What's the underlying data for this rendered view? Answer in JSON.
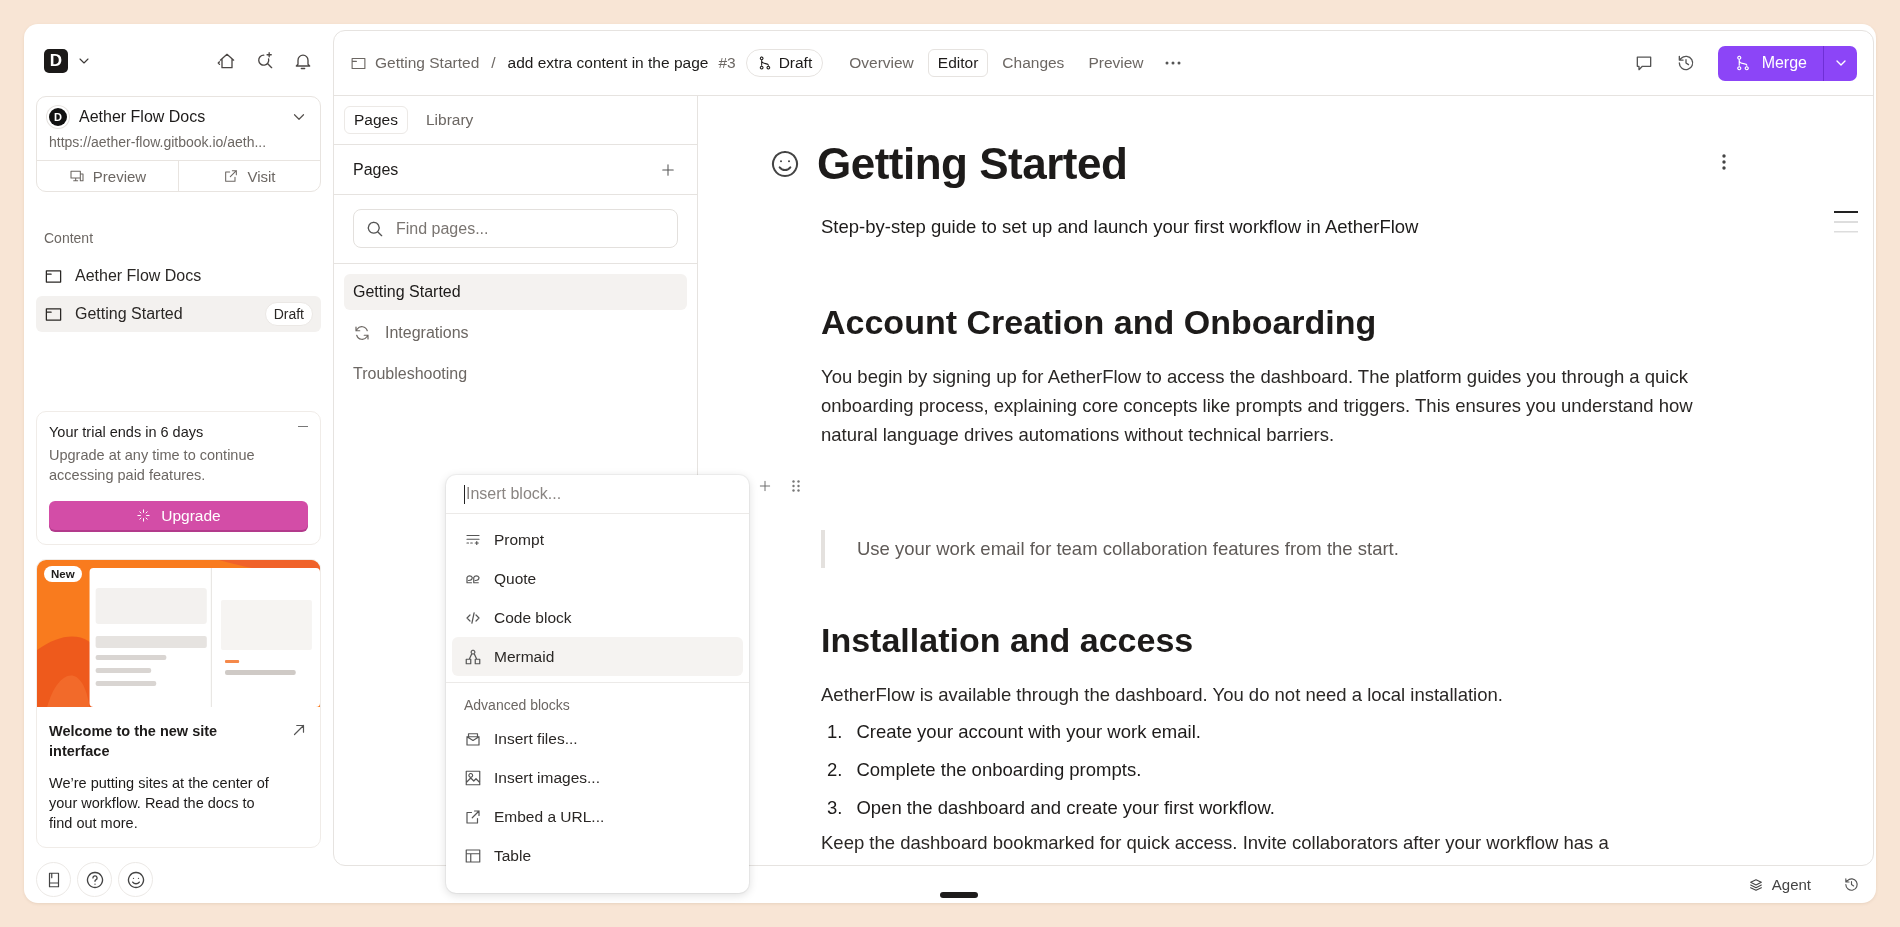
{
  "workspace": {
    "logo": "D"
  },
  "site": {
    "logo": "D",
    "name": "Aether Flow Docs",
    "url": "https://aether-flow.gitbook.io/aeth...",
    "actions": [
      "Preview",
      "Visit"
    ]
  },
  "content": {
    "heading": "Content",
    "items": [
      {
        "label": "Aether Flow Docs",
        "selected": false
      },
      {
        "label": "Getting Started",
        "selected": true,
        "badge": "Draft"
      }
    ]
  },
  "trial": {
    "title": "Your trial ends in 6 days",
    "text": "Upgrade at any time to continue accessing paid features.",
    "button": "Upgrade"
  },
  "promo": {
    "badge": "New",
    "title": "Welcome to the new site interface",
    "text": "We’re putting sites at the center of your workflow. Read the docs to find out more."
  },
  "breadcrumb": {
    "parent": "Getting Started",
    "separator": "/",
    "title": "add extra content in the page",
    "number": "#3",
    "status": "Draft"
  },
  "tabs": [
    {
      "label": "Overview",
      "selected": false
    },
    {
      "label": "Editor",
      "selected": true
    },
    {
      "label": "Changes",
      "selected": false
    },
    {
      "label": "Preview",
      "selected": false
    }
  ],
  "merge_button": "Merge",
  "pages_panel": {
    "tabs": [
      {
        "label": "Pages",
        "selected": true
      },
      {
        "label": "Library",
        "selected": false
      }
    ],
    "heading": "Pages",
    "search": {
      "placeholder": "Find pages..."
    },
    "items": [
      {
        "label": "Getting Started",
        "kind": "page",
        "selected": true
      },
      {
        "label": "Integrations",
        "kind": "integration",
        "selected": false
      },
      {
        "label": "Troubleshooting",
        "kind": "page",
        "selected": false
      }
    ]
  },
  "editor": {
    "title": "Getting Started",
    "description": "Step-by-step guide to set up and launch your first workflow in AetherFlow",
    "blocks": [
      {
        "kind": "heading",
        "text": "Account Creation and Onboarding"
      },
      {
        "kind": "paragraph",
        "text": "You begin by signing up for AetherFlow to access the dashboard. The platform guides you through a quick onboarding process, explaining core concepts like prompts and triggers. This ensures you understand how natural language drives automations without technical barriers."
      },
      {
        "kind": "empty"
      },
      {
        "kind": "quote",
        "text": "Use your work email for team collaboration features from the start."
      },
      {
        "kind": "heading",
        "text": "Installation and access"
      },
      {
        "kind": "paragraph",
        "text": "AetherFlow is available through the dashboard. You do not need a local installation."
      },
      {
        "kind": "list",
        "items": [
          {
            "number": "1.",
            "text": "Create your account with your work email."
          },
          {
            "number": "2.",
            "text": "Complete the onboarding prompts."
          },
          {
            "number": "3.",
            "text": "Open the dashboard and create your first workflow."
          }
        ]
      },
      {
        "kind": "paragraph",
        "text": "Keep the dashboard bookmarked for quick access. Invite collaborators after your workflow has a"
      }
    ]
  },
  "insert_menu": {
    "placeholder": "Insert block...",
    "groups": [
      {
        "items": [
          {
            "label": "Prompt",
            "kind": "prompt",
            "selected": false
          },
          {
            "label": "Quote",
            "kind": "quote",
            "selected": false
          },
          {
            "label": "Code block",
            "kind": "code",
            "selected": false
          },
          {
            "label": "Mermaid",
            "kind": "mermaid",
            "selected": true
          }
        ]
      },
      {
        "heading": "Advanced blocks",
        "items": [
          {
            "label": "Insert files...",
            "kind": "files",
            "selected": false
          },
          {
            "label": "Insert images...",
            "kind": "images",
            "selected": false
          },
          {
            "label": "Embed a URL...",
            "kind": "embed",
            "selected": false
          },
          {
            "label": "Table",
            "kind": "table",
            "selected": false
          }
        ]
      }
    ]
  },
  "bottom_bar": {
    "agent": "Agent"
  }
}
